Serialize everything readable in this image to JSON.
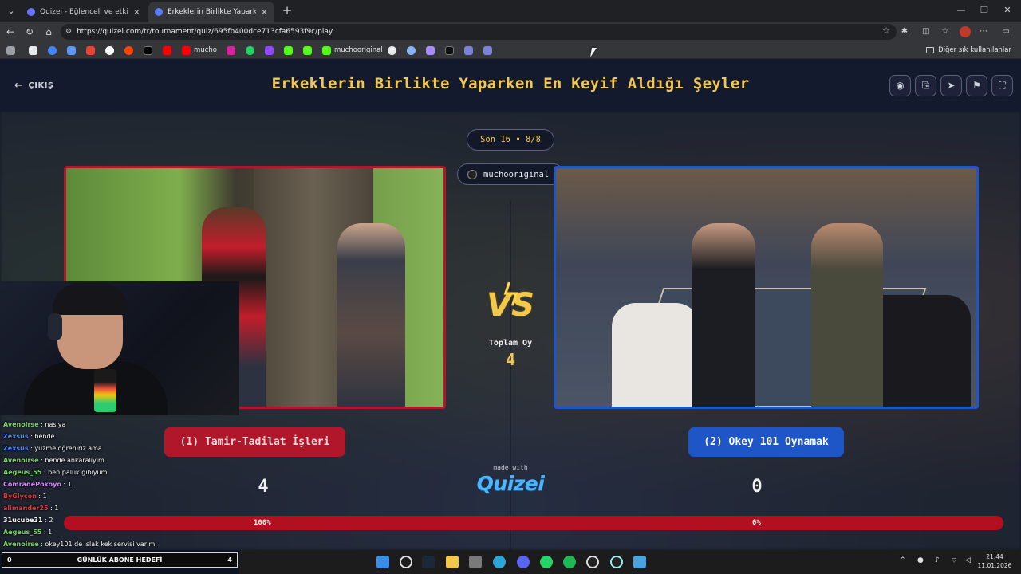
{
  "browser": {
    "tabs": [
      {
        "title": "Quizei - Eğlenceli ve etkileşimli qu",
        "active": false
      },
      {
        "title": "Erkeklerin Birlikte Yaparken En Key",
        "active": true
      }
    ],
    "url": "https://quizei.com/tr/tournament/quiz/695fb400dce713cfa6593f9c/play",
    "bookmarks": [
      "mucho",
      "muchooriginal"
    ],
    "bookmarks_other": "Diğer sık kullanılanlar"
  },
  "quiz": {
    "exit_label": "ÇIKIŞ",
    "title": "Erkeklerin Birlikte Yaparken En Keyif Aldığı Şeyler",
    "round": "Son 16 • 8/8",
    "username": "muchooriginal",
    "vs": "VS",
    "total_label": "Toplam Oy",
    "total_value": "4",
    "left": {
      "label": "(1) Tamir-Tadilat İşleri",
      "votes": "4",
      "percent_text": "100%",
      "percent": 100
    },
    "right": {
      "label": "(2) Okey 101 Oynamak",
      "votes": "0",
      "percent_text": "0%"
    },
    "made_with": "made with",
    "logo": "Quizei",
    "colors": {
      "title": "#f2c94c",
      "left": "#b0172a",
      "right": "#1e56c8",
      "logo": "#49b6ff"
    }
  },
  "chat": [
    {
      "user": "Avenoirse",
      "color": "#7cd66b",
      "msg": " : nasıya"
    },
    {
      "user": "Zexsus",
      "color": "#4f8cff",
      "msg": " : bende"
    },
    {
      "user": "Zexsus",
      "color": "#4f8cff",
      "msg": " : yüzme öğreniriz ama"
    },
    {
      "user": "Avenoirse",
      "color": "#7cd66b",
      "msg": " : bende ankaralıyım"
    },
    {
      "user": "Aegeus_55",
      "color": "#7cd66b",
      "msg": " : ben paluk gibiyum"
    },
    {
      "user": "ComradePokoyo",
      "color": "#d58bff",
      "msg": " : 1"
    },
    {
      "user": "ByGlycon",
      "color": "#e03a3a",
      "msg": " : 1"
    },
    {
      "user": "alimander25",
      "color": "#e03a3a",
      "msg": " : 1"
    },
    {
      "user": "31ucube31",
      "color": "#ffffff",
      "msg": " : 2"
    },
    {
      "user": "Aegeus_55",
      "color": "#7cd66b",
      "msg": " : 1"
    },
    {
      "user": "Avenoirse",
      "color": "#7cd66b",
      "msg": " : okey101 de ıslak kek servisi var mı"
    }
  ],
  "sub_goal": {
    "left": "0",
    "label": "GÜNLÜK ABONE HEDEFİ",
    "right": "4"
  },
  "clock": {
    "time": "21:44",
    "date": "11.01.2026"
  }
}
